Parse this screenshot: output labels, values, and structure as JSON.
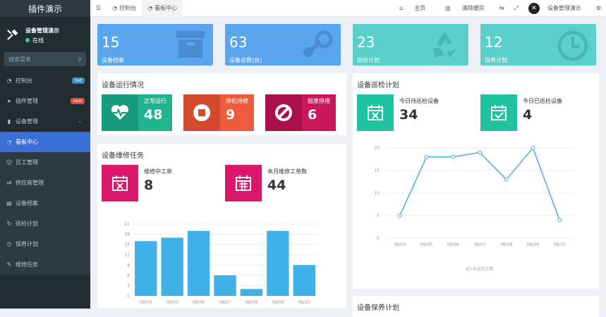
{
  "sidebar": {
    "brand": "插件演示",
    "user_name": "设备管理演示",
    "user_status": "在线",
    "search_placeholder": "搜索菜单",
    "items": [
      {
        "label": "控制台",
        "icon": "dashboard-icon",
        "glyph": "◔",
        "badge": "hot",
        "badge_color": "#3c8dbc"
      },
      {
        "label": "插件管理",
        "icon": "rocket-icon",
        "glyph": "➤",
        "badge": "new",
        "badge_color": "#dd4b39"
      },
      {
        "label": "设备管理",
        "icon": "file-icon",
        "glyph": "▮",
        "badge": "",
        "chevron": "⌄"
      },
      {
        "label": "看板中心",
        "icon": "dashboard-icon",
        "glyph": "◔",
        "badge": ""
      },
      {
        "label": "员工管理",
        "icon": "user-icon",
        "glyph": "☺",
        "badge": ""
      },
      {
        "label": "供应商管理",
        "icon": "handshake-icon",
        "glyph": "⇄",
        "badge": ""
      },
      {
        "label": "设备档案",
        "icon": "archive-icon",
        "glyph": "▤",
        "badge": ""
      },
      {
        "label": "巡检计划",
        "icon": "refresh-icon",
        "glyph": "↻",
        "badge": ""
      },
      {
        "label": "保养计划",
        "icon": "clock-icon",
        "glyph": "◷",
        "badge": ""
      },
      {
        "label": "维修任务",
        "icon": "wrench-icon",
        "glyph": "✎",
        "badge": ""
      }
    ]
  },
  "topbar": {
    "menu_icon": "☰",
    "tabs": [
      "控制台",
      "看板中心"
    ],
    "home": "主页",
    "clear_cache": "清除缓存",
    "user": "设备管理演示"
  },
  "stats": [
    {
      "value": "15",
      "label": "设备档案",
      "color": "#5aa6ee",
      "icon": "archive-icon"
    },
    {
      "value": "63",
      "label": "设备总数(台)",
      "color": "#5aa6ee",
      "icon": "steam-icon"
    },
    {
      "value": "23",
      "label": "巡检计划",
      "color": "#5bcfc9",
      "icon": "recycle-icon"
    },
    {
      "value": "12",
      "label": "保养计划",
      "color": "#5bcfc9",
      "icon": "clock-icon"
    }
  ],
  "status_panel": {
    "title": "设备运行情况",
    "cards": [
      {
        "label": "正常运行",
        "value": "48",
        "color": "#1fb38f",
        "icon_bg": "#189b7c",
        "icon": "heartbeat-icon"
      },
      {
        "label": "停机待修",
        "value": "9",
        "color": "#ef5a3c",
        "icon_bg": "#d44a2f",
        "icon": "stop-icon"
      },
      {
        "label": "报废停用",
        "value": "6",
        "color": "#c8195a",
        "icon_bg": "#aa1049",
        "icon": "ban-icon"
      }
    ]
  },
  "repair_panel": {
    "title": "设备维修任务",
    "cards": [
      {
        "label": "维修中工单",
        "value": "8",
        "color": "#d9196b",
        "icon": "calendar-x-icon"
      },
      {
        "label": "本月维修工单数",
        "value": "44",
        "color": "#d9196b",
        "icon": "calendar-icon"
      }
    ]
  },
  "inspect_panel": {
    "title": "设备巡检计划",
    "cards": [
      {
        "label": "今日待巡检设备",
        "value": "34",
        "color": "#1fc39f",
        "icon": "calendar-x-icon"
      },
      {
        "label": "今日已巡检设备",
        "value": "4",
        "color": "#1fc39f",
        "icon": "calendar-check-icon"
      }
    ]
  },
  "maint_panel": {
    "title": "设备保养计划"
  },
  "chart_data": [
    {
      "type": "bar",
      "categories": [
        "08/04",
        "08/05",
        "08/06",
        "08/07",
        "08/08",
        "08/09",
        "08/10"
      ],
      "values": [
        16,
        17,
        19,
        6,
        2,
        19,
        9
      ],
      "yticks": [
        0,
        3,
        6,
        9,
        12,
        15,
        18,
        21
      ],
      "ylim": [
        0,
        21
      ],
      "color": "#40b0e8",
      "grid": true
    },
    {
      "type": "line",
      "categories": [
        "08/04",
        "08/05",
        "08/06",
        "08/07",
        "08/08",
        "08/09",
        "08/10"
      ],
      "values": [
        5,
        18,
        18,
        19,
        13,
        20,
        4
      ],
      "yticks": [
        0,
        5,
        10,
        15,
        20
      ],
      "ylim": [
        0,
        20
      ],
      "xlabel": "近7天巡检次数",
      "color": "#4aafd8",
      "grid": true
    }
  ]
}
